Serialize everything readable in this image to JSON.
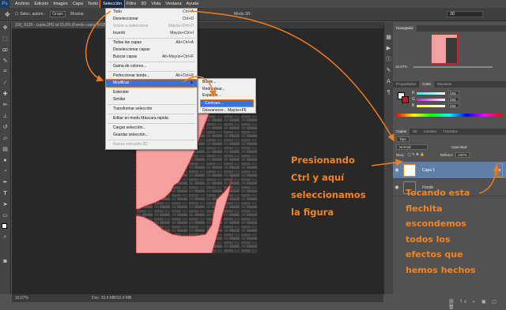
{
  "menubar": {
    "logo": "Ps",
    "items": [
      "Archivo",
      "Edición",
      "Imagen",
      "Capa",
      "Texto",
      "Selección",
      "Filtro",
      "3D",
      "Vista",
      "Ventana",
      "Ayuda"
    ]
  },
  "options": {
    "sample": "Selec. autom.:",
    "group": "Grupo",
    "transform": "Mostrar",
    "mode3d": "Modo 3D:",
    "workspace": "3D"
  },
  "document": {
    "tab_title": "100_9129 - copia.JPG al 15,6% (Fondo copia, RGB/8)",
    "zoom": "16,67%",
    "doc_info": "Doc: 10,4 MB/10,4 MB"
  },
  "selection_menu": {
    "items": [
      {
        "label": "Todo",
        "shortcut": "Ctrl+A"
      },
      {
        "label": "Deseleccionar",
        "shortcut": "Ctrl+D"
      },
      {
        "label": "Volver a seleccionar",
        "shortcut": "Mayús+Ctrl+D"
      },
      {
        "label": "Invertir",
        "shortcut": "Mayús+Ctrl+I"
      },
      {
        "label": "Todas las capas",
        "shortcut": "Alt+Ctrl+A"
      },
      {
        "label": "Deseleccionar capas",
        "shortcut": ""
      },
      {
        "label": "Buscar capas",
        "shortcut": "Alt+Mayús+Ctrl+F"
      },
      {
        "label": "Gama de colores...",
        "shortcut": ""
      },
      {
        "label": "Perfeccionar borde...",
        "shortcut": "Alt+Ctrl+R"
      },
      {
        "label": "Modificar",
        "shortcut": ""
      },
      {
        "label": "Extender",
        "shortcut": ""
      },
      {
        "label": "Similar",
        "shortcut": ""
      },
      {
        "label": "Transformar selección",
        "shortcut": ""
      },
      {
        "label": "Editar en modo Máscara rápida",
        "shortcut": ""
      },
      {
        "label": "Cargar selección...",
        "shortcut": ""
      },
      {
        "label": "Guardar selección...",
        "shortcut": ""
      },
      {
        "label": "Nueva extrusión 3D",
        "shortcut": ""
      }
    ]
  },
  "modify_submenu": {
    "items": [
      "Borde...",
      "Redondear...",
      "Expandir...",
      "Contraer...",
      "Desvanecer... Mayús+F6"
    ]
  },
  "panels": {
    "navigator_tab": "Navegador",
    "navigator_zoom": "16,67%",
    "properties_tab": "Propiedades",
    "color_tab": "Color",
    "swatches_tab": "Muestras",
    "color_r": "255",
    "color_g": "255",
    "color_b": "255",
    "layers_tabs": [
      "Capas",
      "3D",
      "Canales",
      "Trazados"
    ],
    "kind": "Tipo",
    "blend_mode": "Normal",
    "opacity_label": "Opacidad:",
    "lock_label": "Bloq.:",
    "fill_label": "Relleno:",
    "fill_value": "100%",
    "layers": [
      "Capa 1",
      "Fondo"
    ]
  },
  "annotations": {
    "left": "Presionando\nCtrl y aquí\nseleccionamos\nla figura",
    "right": "Tocando esta\nflechita\nescondemos\ntodos los\nefectos que\nhemos hechos"
  },
  "colors": {
    "accent_orange": "#f07c1e",
    "menu_highlight": "#3874d8",
    "selection_fill": "#f4a0a0",
    "annotation_text": "#f5831f"
  }
}
